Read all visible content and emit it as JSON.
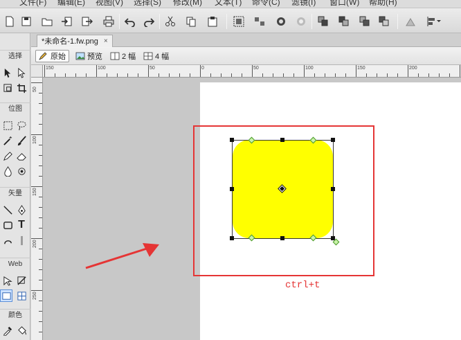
{
  "menu": {
    "items": [
      "文件(F)",
      "编辑(E)",
      "视图(V)",
      "选择(S)",
      "修改(M)",
      "文本(T)",
      "命令(C)",
      "滤镜(I)",
      "窗口(W)",
      "帮助(H)"
    ]
  },
  "toolbar": {
    "icons": [
      "new-icon",
      "save-icon",
      "open-icon",
      "import-icon",
      "export-icon",
      "print-icon",
      "undo-icon",
      "redo-icon",
      "cut-icon",
      "copy-icon",
      "paste-icon",
      "group-icon",
      "ungroup-icon",
      "join-icon",
      "split-icon",
      "bring-front-icon",
      "bring-forward-icon",
      "send-backward-icon",
      "send-back-icon",
      "rotate-icon",
      "align-icon"
    ]
  },
  "document": {
    "tab_title": "*未命名-1.fw.png",
    "close_symbol": "×"
  },
  "viewbar": {
    "original": "原始",
    "preview": "预览",
    "two_up": "2 幅",
    "four_up": "4 幅"
  },
  "tools": {
    "select_label": "选择",
    "bitmap_label": "位图",
    "vector_label": "矢量",
    "web_label": "Web",
    "colors_label": "颜色",
    "text_tool": "T"
  },
  "rulers": {
    "h_labels": [
      "150",
      "100",
      "50",
      "0",
      "50",
      "100",
      "150",
      "200"
    ],
    "v_labels": [
      "50",
      "100",
      "150",
      "200",
      "250"
    ]
  },
  "annotation": {
    "caption": "ctrl+t",
    "color": "#e53535"
  },
  "colors": {
    "shape_fill": "#ffff00",
    "canvas": "#ffffff",
    "pasteboard": "#c8c8c8"
  }
}
